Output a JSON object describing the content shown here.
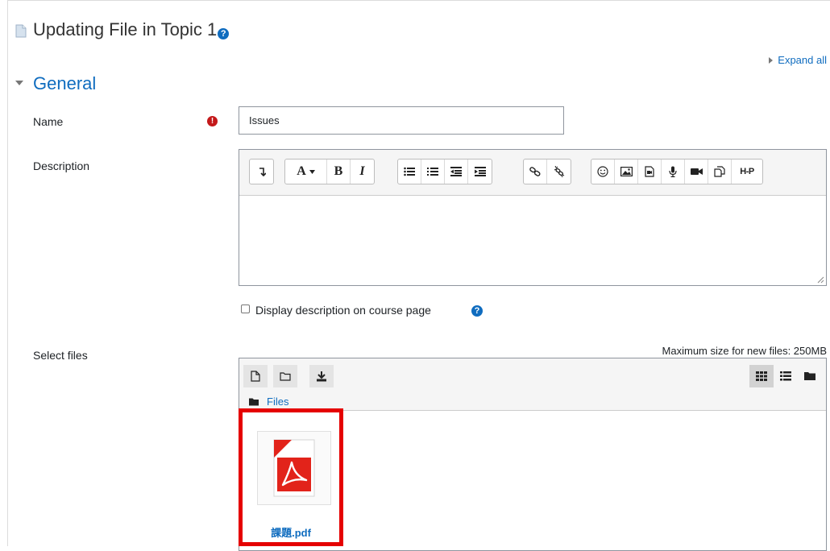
{
  "page": {
    "title": "Updating File in Topic 1",
    "help_glyph": "?"
  },
  "controls": {
    "expand_all": "Expand all"
  },
  "section": {
    "title": "General"
  },
  "form": {
    "name_label": "Name",
    "name_value": "Issues",
    "required_glyph": "!",
    "description_label": "Description",
    "display_description_label": "Display description on course page",
    "display_description_checked": false,
    "select_files_label": "Select files",
    "max_size_text": "Maximum size for new files: 250MB"
  },
  "editor": {
    "font_glyph": "A",
    "bold_glyph": "B",
    "italic_glyph": "I",
    "h5p_label": "H-P",
    "toolbar_icons": [
      "collapse-toolbar-icon",
      "font-style-icon",
      "bold-icon",
      "italic-icon",
      "unordered-list-icon",
      "ordered-list-icon",
      "outdent-icon",
      "indent-icon",
      "link-icon",
      "unlink-icon",
      "emoji-icon",
      "image-icon",
      "media-icon",
      "record-audio-icon",
      "record-video-icon",
      "manage-files-icon",
      "h5p-icon"
    ]
  },
  "filemanager": {
    "path_label": "Files",
    "files": [
      {
        "name": "課題.pdf",
        "icon": "pdf-file-icon"
      }
    ]
  },
  "colors": {
    "link": "#0f6cbf",
    "required": "#c4191a",
    "highlight": "#e50000",
    "pdf_red": "#e2231a"
  }
}
